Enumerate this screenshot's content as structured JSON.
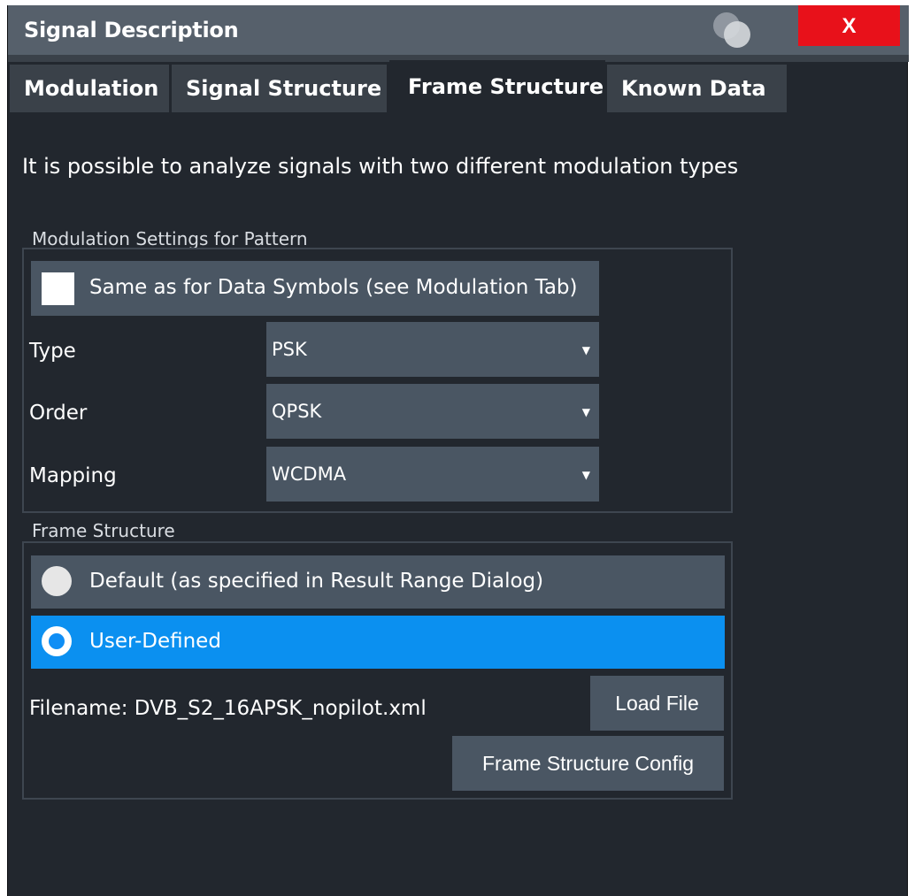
{
  "window": {
    "title": "Signal Description",
    "close_label": "X"
  },
  "tabs": [
    {
      "label": "Modulation",
      "active": false
    },
    {
      "label": "Signal Structure",
      "active": false
    },
    {
      "label": "Frame Structure",
      "active": true
    },
    {
      "label": "Known Data",
      "active": false
    }
  ],
  "description": "It is possible to analyze signals with two different modulation types",
  "modulation_settings": {
    "group_label": "Modulation Settings for Pattern",
    "same_as_label": "Same as for Data Symbols (see Modulation Tab)",
    "same_as_checked": false,
    "type_label": "Type",
    "type_value": "PSK",
    "order_label": "Order",
    "order_value": "QPSK",
    "mapping_label": "Mapping",
    "mapping_value": "WCDMA"
  },
  "frame_structure": {
    "group_label": "Frame Structure",
    "default_label": "Default (as specified in Result Range Dialog)",
    "user_defined_label": "User-Defined",
    "selected": "user_defined",
    "filename_label": "Filename:",
    "filename_value": "DVB_S2_16APSK_nopilot.xml",
    "load_file_label": "Load File",
    "config_label": "Frame Structure Config"
  },
  "colors": {
    "background": "#22272e",
    "titlebar": "#56606b",
    "control": "#4a5663",
    "accent": "#0b90f0",
    "close": "#e8111a"
  }
}
